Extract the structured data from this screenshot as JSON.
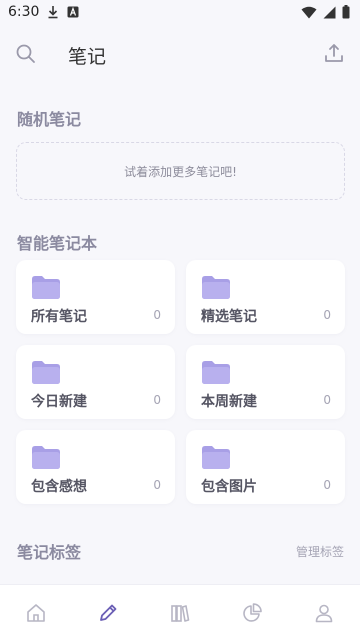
{
  "status_bar": {
    "time": "6:30",
    "icons": [
      "download-icon",
      "a-badge-icon",
      "wifi-icon",
      "signal-icon",
      "battery-icon"
    ]
  },
  "header": {
    "title": "笔记",
    "icons": [
      "search-icon",
      "export-icon"
    ]
  },
  "random_notes": {
    "title": "随机笔记",
    "empty_text": "试着添加更多笔记吧!"
  },
  "smart_notebooks": {
    "title": "智能笔记本",
    "items": [
      {
        "label": "所有笔记",
        "count": "0"
      },
      {
        "label": "精选笔记",
        "count": "0"
      },
      {
        "label": "今日新建",
        "count": "0"
      },
      {
        "label": "本周新建",
        "count": "0"
      },
      {
        "label": "包含感想",
        "count": "0"
      },
      {
        "label": "包含图片",
        "count": "0"
      }
    ]
  },
  "tags": {
    "title": "笔记标签",
    "manage_label": "管理标签"
  },
  "bottom_nav": {
    "items": [
      "home-icon",
      "pencil-icon",
      "books-icon",
      "pie-chart-icon",
      "profile-icon"
    ],
    "active": "pencil-icon"
  },
  "colors": {
    "accent": "#6b5fb5",
    "folder": "#b8b0ee",
    "folder_tab": "#a89fe6",
    "muted": "#8b8aa0",
    "background": "#f7f7fb"
  }
}
